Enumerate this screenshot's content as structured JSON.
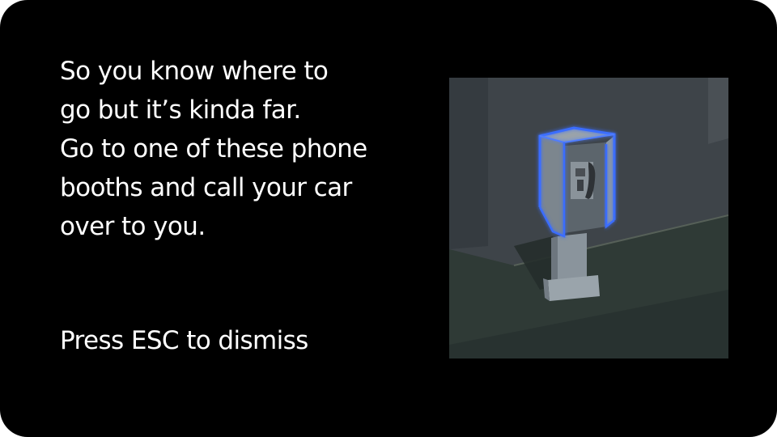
{
  "tutorial": {
    "message": "So you know where to\ngo but it’s kinda far.\nGo to one of these phone\nbooths and call your car\nover to you.",
    "dismiss_hint": "Press ESC to dismiss"
  },
  "preview": {
    "subject": "phone-booth",
    "highlight_color": "#3a6dff"
  },
  "colors": {
    "panel_background": "#000000",
    "text": "#ffffff"
  }
}
